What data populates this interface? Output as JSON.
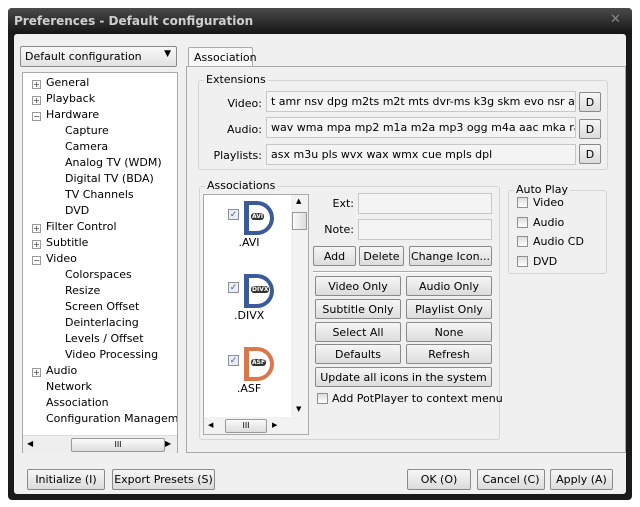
{
  "window": {
    "title": "Preferences - Default configuration",
    "close_icon": "close-icon"
  },
  "config_select": {
    "value": "Default configuration"
  },
  "tree": {
    "items": [
      {
        "label": "General",
        "level": 0,
        "expander": "+"
      },
      {
        "label": "Playback",
        "level": 0,
        "expander": "+"
      },
      {
        "label": "Hardware",
        "level": 0,
        "expander": "-"
      },
      {
        "label": "Capture",
        "level": 1
      },
      {
        "label": "Camera",
        "level": 1
      },
      {
        "label": "Analog TV (WDM)",
        "level": 1
      },
      {
        "label": "Digital TV (BDA)",
        "level": 1
      },
      {
        "label": "TV Channels",
        "level": 1
      },
      {
        "label": "DVD",
        "level": 1
      },
      {
        "label": "Filter Control",
        "level": 0,
        "expander": "+"
      },
      {
        "label": "Subtitle",
        "level": 0,
        "expander": "+"
      },
      {
        "label": "Video",
        "level": 0,
        "expander": "-"
      },
      {
        "label": "Colorspaces",
        "level": 1
      },
      {
        "label": "Resize",
        "level": 1
      },
      {
        "label": "Screen Offset",
        "level": 1
      },
      {
        "label": "Deinterlacing",
        "level": 1
      },
      {
        "label": "Levels / Offset",
        "level": 1
      },
      {
        "label": "Video Processing",
        "level": 1
      },
      {
        "label": "Audio",
        "level": 0,
        "expander": "+"
      },
      {
        "label": "Network",
        "level": 0
      },
      {
        "label": "Association",
        "level": 0,
        "selected": true
      },
      {
        "label": "Configuration Management",
        "level": 0
      }
    ],
    "hscroll_thumb": "III"
  },
  "tab": {
    "label": "Association"
  },
  "extensions": {
    "legend": "Extensions",
    "video_label": "Video:",
    "video_value": "t amr nsv dpg m2ts m2t mts dvr-ms k3g skm evo nsr amv divx",
    "audio_label": "Audio:",
    "audio_value": "wav wma mpa mp2 m1a m2a mp3 ogg m4a aac mka ra flac ape",
    "playlists_label": "Playlists:",
    "playlists_value": "asx m3u pls wvx wax wmx cue mpls dpl",
    "default_button": "D"
  },
  "associations": {
    "legend": "Associations",
    "items": [
      {
        "ext": ".AVI",
        "tag": "AVI",
        "color": "#3b5a9a",
        "checked": true
      },
      {
        "ext": ".DIVX",
        "tag": "DIVX",
        "color": "#3b5a9a",
        "checked": true
      },
      {
        "ext": ".ASF",
        "tag": "ASF",
        "color": "#d9784a",
        "checked": true
      }
    ],
    "hscroll_thumb": "III",
    "ext_label": "Ext:",
    "ext_value": "",
    "note_label": "Note:",
    "note_value": "",
    "add": "Add",
    "delete": "Delete",
    "change_icon": "Change Icon...",
    "video_only": "Video Only",
    "audio_only": "Audio Only",
    "subtitle_only": "Subtitle Only",
    "playlist_only": "Playlist Only",
    "select_all": "Select All",
    "none": "None",
    "defaults": "Defaults",
    "refresh": "Refresh",
    "update_icons": "Update all icons in the system",
    "context_menu": "Add PotPlayer to context menu",
    "context_menu_checked": false
  },
  "autoplay": {
    "legend": "Auto Play",
    "items": [
      {
        "label": "Video",
        "checked": false
      },
      {
        "label": "Audio",
        "checked": false
      },
      {
        "label": "Audio CD",
        "checked": false
      },
      {
        "label": "DVD",
        "checked": false
      }
    ]
  },
  "footer": {
    "initialize": "Initialize (I)",
    "export": "Export Presets (S)",
    "ok": "OK (O)",
    "cancel": "Cancel (C)",
    "apply": "Apply (A)"
  }
}
